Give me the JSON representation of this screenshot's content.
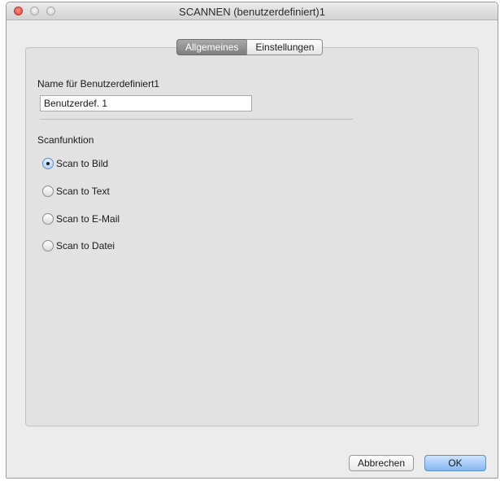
{
  "window": {
    "title": "SCANNEN (benutzerdefiniert)1"
  },
  "tabs": [
    {
      "label": "Allgemeines",
      "active": true
    },
    {
      "label": "Einstellungen",
      "active": false
    }
  ],
  "general": {
    "name_label": "Name für Benutzerdefiniert1",
    "name_value": "Benutzerdef. 1",
    "scan_function_label": "Scanfunktion",
    "scan_options": [
      {
        "label": "Scan to Bild",
        "selected": true
      },
      {
        "label": "Scan to Text",
        "selected": false
      },
      {
        "label": "Scan to E-Mail",
        "selected": false
      },
      {
        "label": "Scan to Datei",
        "selected": false
      }
    ]
  },
  "buttons": {
    "cancel": "Abbrechen",
    "ok": "OK"
  },
  "colors": {
    "accent": "#83b7f0",
    "close_button": "#d9463c"
  }
}
